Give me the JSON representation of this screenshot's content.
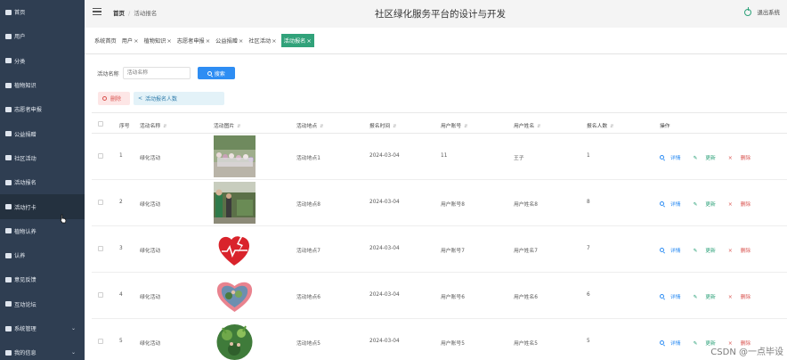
{
  "sidebar": {
    "items": [
      {
        "label": "首页"
      },
      {
        "label": "用户"
      },
      {
        "label": "分类"
      },
      {
        "label": "植物知识"
      },
      {
        "label": "志愿者申报"
      },
      {
        "label": "公益捐赠"
      },
      {
        "label": "社区活动"
      },
      {
        "label": "活动报名"
      },
      {
        "label": "活动打卡"
      },
      {
        "label": "植物认养"
      },
      {
        "label": "认养"
      },
      {
        "label": "意见反馈"
      },
      {
        "label": "互动论坛"
      },
      {
        "label": "系统管理"
      },
      {
        "label": "我的信息"
      }
    ]
  },
  "header": {
    "breadcrumb_home": "首页",
    "breadcrumb_current": "活动报名",
    "title": "社区绿化服务平台的设计与开发",
    "logout": "退出系统"
  },
  "tags": [
    {
      "label": "系统首页",
      "closable": false
    },
    {
      "label": "用户",
      "closable": true
    },
    {
      "label": "植物知识",
      "closable": true
    },
    {
      "label": "志愿者申报",
      "closable": true
    },
    {
      "label": "公益捐赠",
      "closable": true
    },
    {
      "label": "社区活动",
      "closable": true
    },
    {
      "label": "活动报名",
      "closable": true,
      "active": true
    }
  ],
  "search": {
    "label": "活动名称",
    "placeholder": "活动名称",
    "button": "搜索"
  },
  "actions": {
    "delete": "删除",
    "count": "活动报名人数"
  },
  "table": {
    "headers": [
      "序号",
      "活动名称",
      "活动图片",
      "活动地点",
      "报名时间",
      "用户账号",
      "用户姓名",
      "报名人数",
      "操作"
    ],
    "rows": [
      {
        "no": "1",
        "name": "绿化活动",
        "place": "活动地点1",
        "time": "2024-03-04",
        "account": "11",
        "user": "王子",
        "count": "1"
      },
      {
        "no": "2",
        "name": "绿化活动",
        "place": "活动地点8",
        "time": "2024-03-04",
        "account": "用户账号8",
        "user": "用户姓名8",
        "count": "8"
      },
      {
        "no": "3",
        "name": "绿化活动",
        "place": "活动地点7",
        "time": "2024-03-04",
        "account": "用户账号7",
        "user": "用户姓名7",
        "count": "7"
      },
      {
        "no": "4",
        "name": "绿化活动",
        "place": "活动地点6",
        "time": "2024-03-04",
        "account": "用户账号6",
        "user": "用户姓名6",
        "count": "6"
      },
      {
        "no": "5",
        "name": "绿化活动",
        "place": "活动地点5",
        "time": "2024-03-04",
        "account": "用户账号5",
        "user": "用户姓名5",
        "count": "5"
      }
    ],
    "ops": {
      "detail": "详情",
      "update": "更新",
      "delete": "删除"
    }
  },
  "watermark": "CSDN @一点毕设",
  "colors": {
    "sidebar": "#2f3e52",
    "accent": "#31a27a",
    "primary": "#2e8df3",
    "danger": "#d9534f"
  }
}
